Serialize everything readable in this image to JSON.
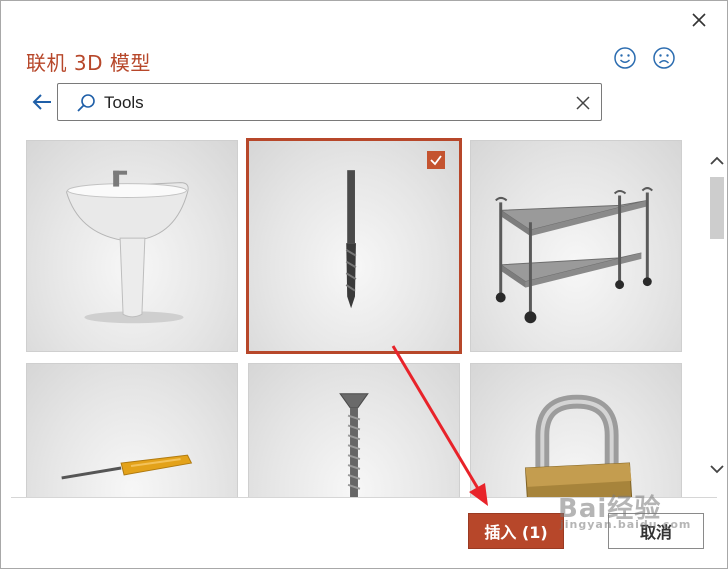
{
  "dialog": {
    "title": "联机 3D 模型"
  },
  "search": {
    "value": "Tools",
    "placeholder": ""
  },
  "results": [
    {
      "name": "washbasin",
      "selected": false
    },
    {
      "name": "drill-bit",
      "selected": true
    },
    {
      "name": "utility-cart",
      "selected": false
    },
    {
      "name": "screwdriver",
      "selected": false
    },
    {
      "name": "screw",
      "selected": false
    },
    {
      "name": "padlock",
      "selected": false
    }
  ],
  "footer": {
    "insert_label": "插入 (1)",
    "cancel_label": "取消"
  },
  "watermark": {
    "brand": "Bai经验",
    "url": "jingyan.baidu.com"
  },
  "colors": {
    "accent": "#b7472a",
    "annotation_arrow": "#e8232a"
  },
  "icons": [
    "close-icon",
    "smile-icon",
    "frown-icon",
    "back-arrow-icon",
    "search-icon",
    "clear-icon",
    "checkmark-icon",
    "scroll-up-icon",
    "scroll-down-icon"
  ]
}
